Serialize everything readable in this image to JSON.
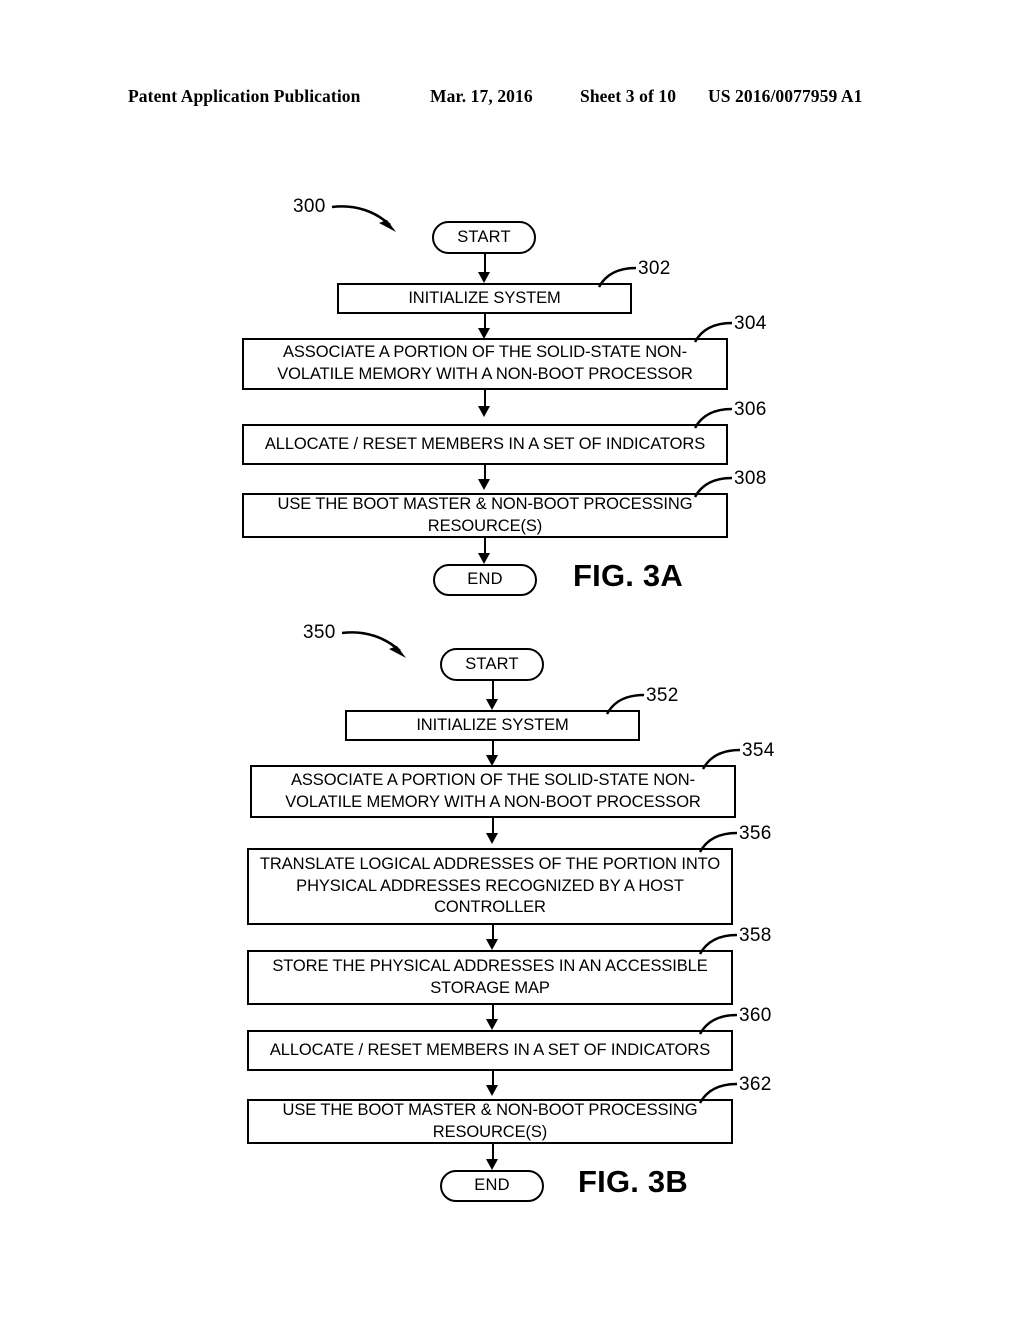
{
  "header": {
    "publication": "Patent Application Publication",
    "date": "Mar. 17, 2016",
    "sheet": "Sheet 3 of 10",
    "patent_number": "US 2016/0077959 A1"
  },
  "figures": [
    {
      "id": "fig-3a",
      "caption": "FIG. 3A",
      "flow_id": "300",
      "nodes": [
        {
          "name": "start",
          "type": "terminal",
          "label": "START",
          "ref": ""
        },
        {
          "name": "initialize-system",
          "type": "process",
          "label": "INITIALIZE SYSTEM",
          "ref": "302"
        },
        {
          "name": "associate-portion",
          "type": "process",
          "label": "ASSOCIATE A PORTION OF THE SOLID-STATE NON-VOLATILE MEMORY WITH A NON-BOOT PROCESSOR",
          "ref": "304"
        },
        {
          "name": "allocate-reset-members",
          "type": "process",
          "label": "ALLOCATE / RESET MEMBERS IN A SET OF INDICATORS",
          "ref": "306"
        },
        {
          "name": "use-boot-master",
          "type": "process",
          "label": "USE THE BOOT MASTER & NON-BOOT PROCESSING RESOURCE(S)",
          "ref": "308"
        },
        {
          "name": "end",
          "type": "terminal",
          "label": "END",
          "ref": ""
        }
      ]
    },
    {
      "id": "fig-3b",
      "caption": "FIG. 3B",
      "flow_id": "350",
      "nodes": [
        {
          "name": "start",
          "type": "terminal",
          "label": "START",
          "ref": ""
        },
        {
          "name": "initialize-system",
          "type": "process",
          "label": "INITIALIZE SYSTEM",
          "ref": "352"
        },
        {
          "name": "associate-portion",
          "type": "process",
          "label": "ASSOCIATE A PORTION OF THE SOLID-STATE NON-VOLATILE MEMORY WITH A NON-BOOT PROCESSOR",
          "ref": "354"
        },
        {
          "name": "translate-logical-addresses",
          "type": "process",
          "label": "TRANSLATE LOGICAL ADDRESSES OF THE PORTION INTO PHYSICAL ADDRESSES RECOGNIZED BY A HOST CONTROLLER",
          "ref": "356"
        },
        {
          "name": "store-physical-addresses",
          "type": "process",
          "label": "STORE THE PHYSICAL ADDRESSES IN AN ACCESSIBLE STORAGE MAP",
          "ref": "358"
        },
        {
          "name": "allocate-reset-members",
          "type": "process",
          "label": "ALLOCATE / RESET MEMBERS IN A SET OF INDICATORS",
          "ref": "360"
        },
        {
          "name": "use-boot-master",
          "type": "process",
          "label": "USE THE BOOT MASTER & NON-BOOT PROCESSING RESOURCE(S)",
          "ref": "362"
        },
        {
          "name": "end",
          "type": "terminal",
          "label": "END",
          "ref": ""
        }
      ]
    }
  ]
}
